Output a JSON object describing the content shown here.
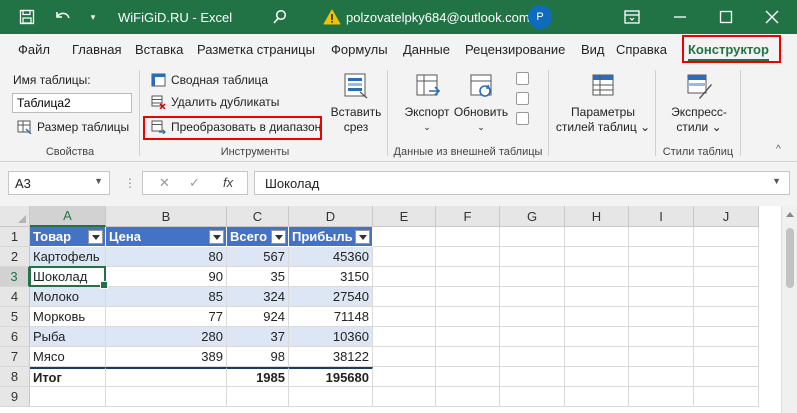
{
  "titlebar": {
    "title": "WiFiGiD.RU  -  Excel",
    "email": "polzovatelpky684@outlook.com",
    "avatar": "P",
    "icons": [
      "save-icon",
      "undo-icon",
      "chevron-down-icon",
      "search-icon",
      "warning-icon",
      "ribbon-display-icon",
      "minimize-icon",
      "maximize-icon",
      "close-icon"
    ]
  },
  "tabs": [
    "Файл",
    "Главная",
    "Вставка",
    "Разметка страницы",
    "Формулы",
    "Данные",
    "Рецензирование",
    "Вид",
    "Справка",
    "Конструктор"
  ],
  "active_tab": "Конструктор",
  "ribbon": {
    "properties": {
      "table_name_label": "Имя таблицы:",
      "table_name_value": "Таблица2",
      "resize_label": "Размер таблицы",
      "group_label": "Свойства"
    },
    "tools": {
      "pivot_label": "Сводная таблица",
      "remove_dup_label": "Удалить дубликаты",
      "convert_label": "Преобразовать в диапазон",
      "slicer_label_1": "Вставить",
      "slicer_label_2": "срез",
      "group_label": "Инструменты"
    },
    "external": {
      "export_label": "Экспорт",
      "refresh_label": "Обновить",
      "group_label": "Данные из внешней таблицы"
    },
    "style_options": {
      "label_1": "Параметры",
      "label_2": "стилей таблиц"
    },
    "styles": {
      "label_1": "Экспресс-",
      "label_2": "стили",
      "group_label": "Стили таблиц"
    }
  },
  "formula_bar": {
    "name_box": "A3",
    "formula": "Шоколад"
  },
  "grid": {
    "columns": [
      "A",
      "B",
      "C",
      "D",
      "E",
      "F",
      "G",
      "H",
      "I",
      "J"
    ],
    "rows": [
      "1",
      "2",
      "3",
      "4",
      "5",
      "6",
      "7",
      "8",
      "9"
    ],
    "active_cell": "A3",
    "table": {
      "headers": [
        "Товар",
        "Цена",
        "Всего",
        "Прибыль"
      ],
      "rows": [
        [
          "Картофель",
          "80",
          "567",
          "45360"
        ],
        [
          "Шоколад",
          "90",
          "35",
          "3150"
        ],
        [
          "Молоко",
          "85",
          "324",
          "27540"
        ],
        [
          "Морковь",
          "77",
          "924",
          "71148"
        ],
        [
          "Рыба",
          "280",
          "37",
          "10360"
        ],
        [
          "Мясо",
          "389",
          "98",
          "38122"
        ]
      ],
      "total": [
        "Итог",
        "",
        "1985",
        "195680"
      ]
    }
  },
  "colors": {
    "excel_green": "#217346",
    "table_header": "#4472c4",
    "band": "#dce6f4",
    "highlight_red": "#e00000"
  }
}
